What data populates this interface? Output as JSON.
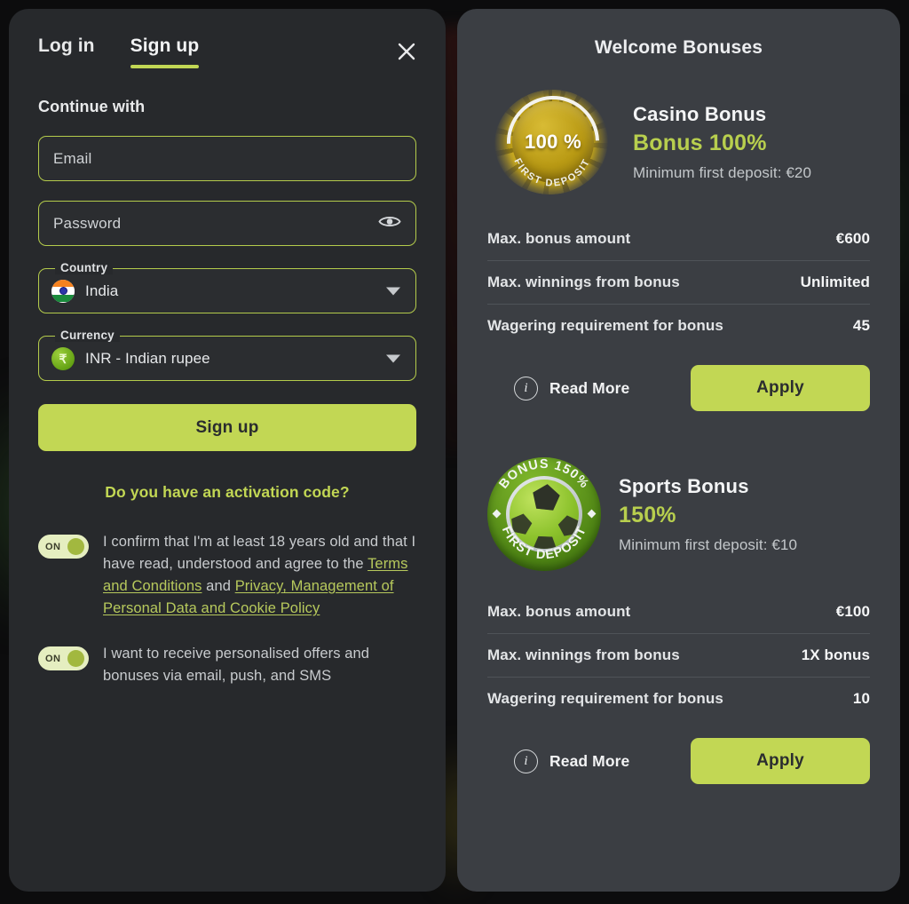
{
  "auth": {
    "tabs": [
      {
        "label": "Log in",
        "active": false
      },
      {
        "label": "Sign up",
        "active": true
      }
    ],
    "close_icon": "close-icon",
    "continue_with": "Continue with",
    "email": {
      "placeholder": "Email",
      "value": ""
    },
    "password": {
      "placeholder": "Password",
      "value": "",
      "reveal_icon": "eye-icon"
    },
    "country": {
      "legend": "Country",
      "value": "India",
      "flag": "india-flag-icon"
    },
    "currency": {
      "legend": "Currency",
      "value": "INR - Indian rupee",
      "symbol": "₹"
    },
    "submit_label": "Sign up",
    "activation_code_link": "Do you have an activation code?",
    "consents": [
      {
        "toggle_state": "ON",
        "text_parts": [
          {
            "type": "text",
            "value": "I confirm that I'm at least 18 years old and that I have read, understood and agree to the "
          },
          {
            "type": "link",
            "value": "Terms and Conditions"
          },
          {
            "type": "text",
            "value": " and "
          },
          {
            "type": "link",
            "value": "Privacy, Management of Personal Data and Cookie Policy"
          }
        ]
      },
      {
        "toggle_state": "ON",
        "text_parts": [
          {
            "type": "text",
            "value": "I want to receive personalised offers and bonuses via email, push, and SMS"
          }
        ]
      }
    ]
  },
  "bonuses": {
    "title": "Welcome Bonuses",
    "cards": [
      {
        "badge": {
          "kind": "gold-coin-badge",
          "center_text": "100 %",
          "arc_bottom_text": "FIRST DEPOSIT"
        },
        "name": "Casino Bonus",
        "amount": "Bonus 100%",
        "min_deposit": "Minimum first deposit: €20",
        "stats": [
          {
            "label": "Max. bonus amount",
            "value": "€600"
          },
          {
            "label": "Max. winnings from bonus",
            "value": "Unlimited"
          },
          {
            "label": "Wagering requirement for bonus",
            "value": "45"
          }
        ],
        "read_more_label": "Read More",
        "apply_label": "Apply"
      },
      {
        "badge": {
          "kind": "green-football-badge",
          "arc_top_text": "BONUS 150%",
          "arc_bottom_text": "FIRST DEPOSIT"
        },
        "name": "Sports Bonus",
        "amount": "150%",
        "min_deposit": "Minimum first deposit: €10",
        "stats": [
          {
            "label": "Max. bonus amount",
            "value": "€100"
          },
          {
            "label": "Max. winnings from bonus",
            "value": "1X bonus"
          },
          {
            "label": "Wagering requirement for bonus",
            "value": "10"
          }
        ],
        "read_more_label": "Read More",
        "apply_label": "Apply"
      }
    ]
  },
  "colors": {
    "accent_green": "#c2d754",
    "link_green": "#b7c95c",
    "panel_left_bg": "#27292c",
    "panel_right_bg": "#3b3e43",
    "page_bg": "#0c0c0d"
  }
}
